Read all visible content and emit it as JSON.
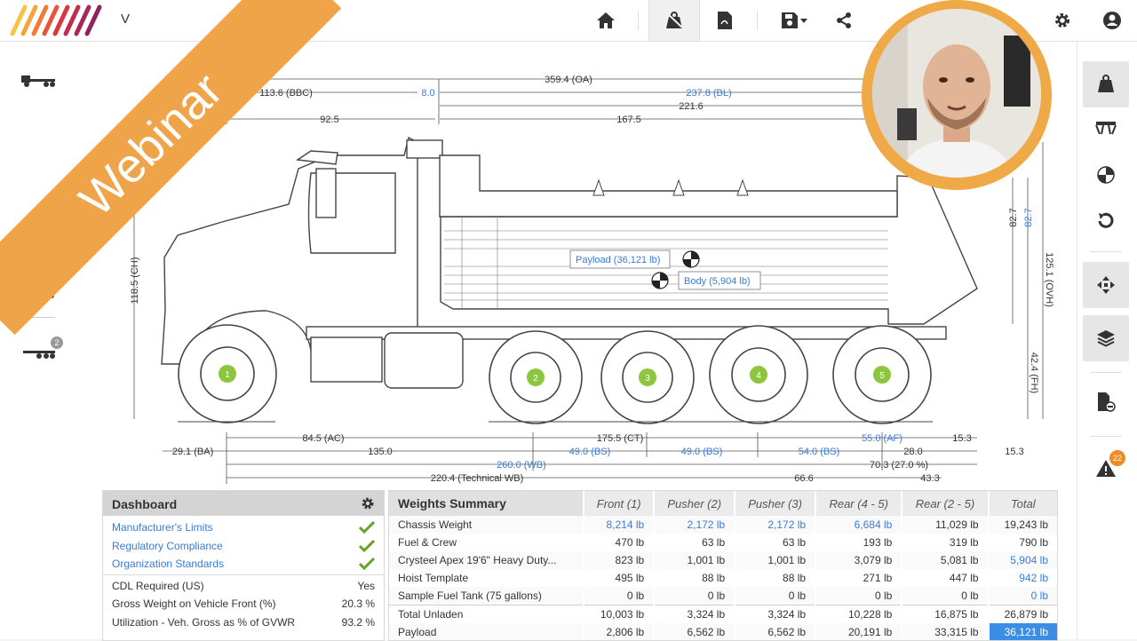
{
  "app": {
    "title_visible": "V",
    "title_tail": ")"
  },
  "banner": {
    "text": "Webinar"
  },
  "dims": {
    "oa": "359.4 (OA)",
    "bbc": "113.6 (BBC)",
    "gap8": "8.0",
    "bl": "237.8 (BL)",
    "d2216": "221.6",
    "d925": "92.5",
    "d1675": "167.5",
    "ch": "118.5 (CH)",
    "d827a": "82.7",
    "d827b": "82.7",
    "ovh": "125.1 (OVH)",
    "fh": "42.4 (FH)",
    "ac": "84.5 (AC)",
    "ct": "175.5 (CT)",
    "af": "55.0 (AF)",
    "d153a": "15.3",
    "ba": "29.1 (BA)",
    "d1350": "135.0",
    "bs1": "49.0 (BS)",
    "bs2": "49.0 (BS)",
    "bs3": "54.0 (BS)",
    "d280": "28.0",
    "d153b": "15.3",
    "wb": "260.0 (WB)",
    "d703": "70.3 (27.0 %)",
    "twb": "220.4 (Technical WB)",
    "d666": "66.6",
    "d433": "43.3",
    "payload_label": "Payload (36,121 lb)",
    "body_label": "Body (5,904 lb)",
    "axles": [
      "1",
      "2",
      "3",
      "4",
      "5"
    ]
  },
  "left_units": {
    "unit1": "1",
    "unit2": "2"
  },
  "alert_count": "22",
  "dashboard": {
    "title": "Dashboard",
    "links": [
      "Manufacturer's Limits",
      "Regulatory Compliance",
      "Organization Standards"
    ],
    "rows": [
      {
        "label": "CDL Required (US)",
        "value": "Yes"
      },
      {
        "label": "Gross Weight on Vehicle Front (%)",
        "value": "20.3 %"
      },
      {
        "label": "Utilization - Veh. Gross as % of GVWR",
        "value": "93.2 %"
      }
    ]
  },
  "weights": {
    "title": "Weights Summary",
    "columns": [
      "Front (1)",
      "Pusher (2)",
      "Pusher (3)",
      "Rear (4 - 5)",
      "Rear (2 - 5)",
      "Total"
    ],
    "rows": [
      {
        "label": "Chassis Weight",
        "values": [
          "8,214 lb",
          "2,172 lb",
          "2,172 lb",
          "6,684 lb",
          "11,029 lb",
          "19,243 lb"
        ]
      },
      {
        "label": "Fuel & Crew",
        "values": [
          "470 lb",
          "63 lb",
          "63 lb",
          "193 lb",
          "319 lb",
          "790 lb"
        ]
      },
      {
        "label": "Crysteel Apex 19'6\" Heavy Duty...",
        "values": [
          "823 lb",
          "1,001 lb",
          "1,001 lb",
          "3,079 lb",
          "5,081 lb",
          "5,904 lb"
        ]
      },
      {
        "label": "Hoist Template",
        "values": [
          "495 lb",
          "88 lb",
          "88 lb",
          "271 lb",
          "447 lb",
          "942 lb"
        ]
      },
      {
        "label": "Sample Fuel Tank (75 gallons)",
        "values": [
          "0 lb",
          "0 lb",
          "0 lb",
          "0 lb",
          "0 lb",
          "0 lb"
        ]
      },
      {
        "label": "Total Unladen",
        "values": [
          "10,003 lb",
          "3,324 lb",
          "3,324 lb",
          "10,228 lb",
          "16,875 lb",
          "26,879 lb"
        ]
      },
      {
        "label": "Payload",
        "values": [
          "2,806 lb",
          "6,562 lb",
          "6,562 lb",
          "20,191 lb",
          "33,315 lb",
          "36,121 lb"
        ]
      }
    ]
  }
}
